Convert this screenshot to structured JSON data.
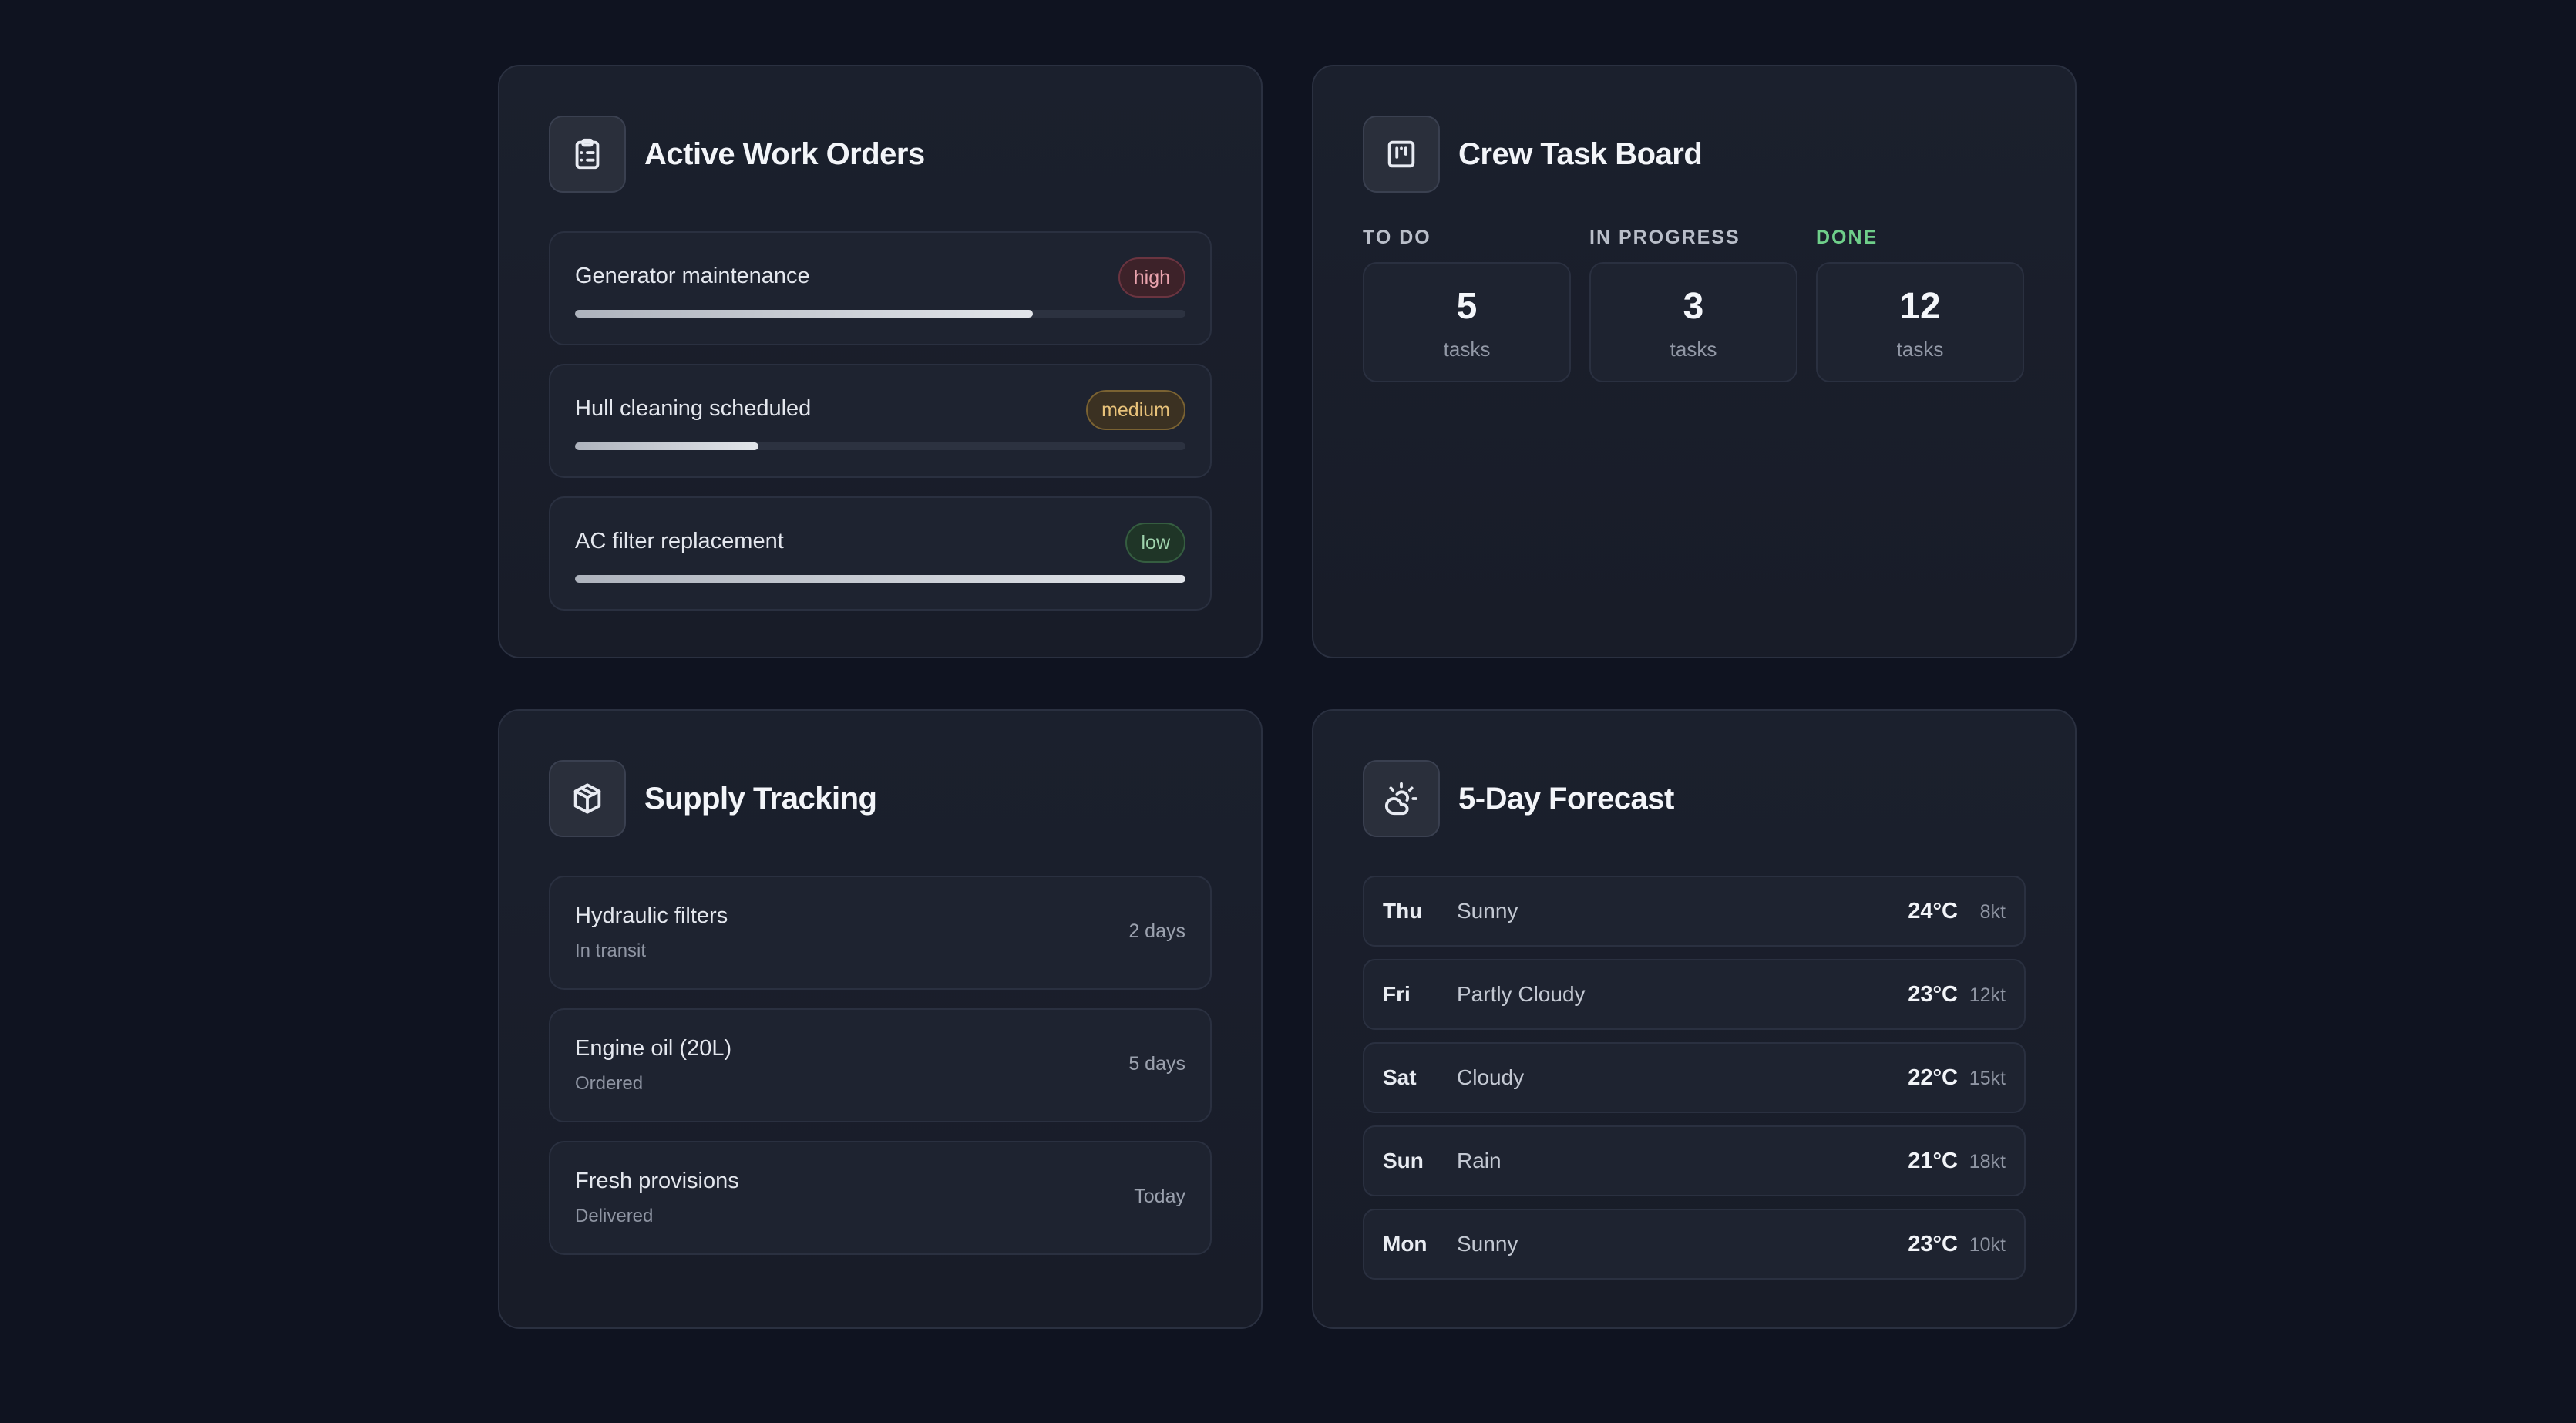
{
  "work_orders": {
    "title": "Active Work Orders",
    "items": [
      {
        "name": "Generator maintenance",
        "priority": "high",
        "progress": 0.75
      },
      {
        "name": "Hull cleaning scheduled",
        "priority": "medium",
        "progress": 0.3
      },
      {
        "name": "AC filter replacement",
        "priority": "low",
        "progress": 1.0
      }
    ]
  },
  "task_board": {
    "title": "Crew Task Board",
    "columns": [
      {
        "label": "TO DO",
        "count": "5",
        "unit": "tasks"
      },
      {
        "label": "IN PROGRESS",
        "count": "3",
        "unit": "tasks"
      },
      {
        "label": "DONE",
        "count": "12",
        "unit": "tasks"
      }
    ]
  },
  "supply": {
    "title": "Supply Tracking",
    "items": [
      {
        "name": "Hydraulic filters",
        "status": "In transit",
        "eta": "2 days"
      },
      {
        "name": "Engine oil (20L)",
        "status": "Ordered",
        "eta": "5 days"
      },
      {
        "name": "Fresh provisions",
        "status": "Delivered",
        "eta": "Today"
      }
    ]
  },
  "forecast": {
    "title": "5-Day Forecast",
    "days": [
      {
        "day": "Thu",
        "condition": "Sunny",
        "temp": "24°C",
        "wind": "8kt"
      },
      {
        "day": "Fri",
        "condition": "Partly Cloudy",
        "temp": "23°C",
        "wind": "12kt"
      },
      {
        "day": "Sat",
        "condition": "Cloudy",
        "temp": "22°C",
        "wind": "15kt"
      },
      {
        "day": "Sun",
        "condition": "Rain",
        "temp": "21°C",
        "wind": "18kt"
      },
      {
        "day": "Mon",
        "condition": "Sunny",
        "temp": "23°C",
        "wind": "10kt"
      }
    ]
  },
  "icons": {
    "work_orders": "clipboard-list-icon",
    "task_board": "kanban-icon",
    "supply": "package-icon",
    "forecast": "cloud-sun-icon"
  },
  "colors": {
    "background": "#0f1320",
    "card": "#1b202d",
    "priority_high": "#e9a3ad",
    "priority_medium": "#e8c27a",
    "priority_low": "#9fd3ad",
    "done_label": "#6fcf8a"
  }
}
